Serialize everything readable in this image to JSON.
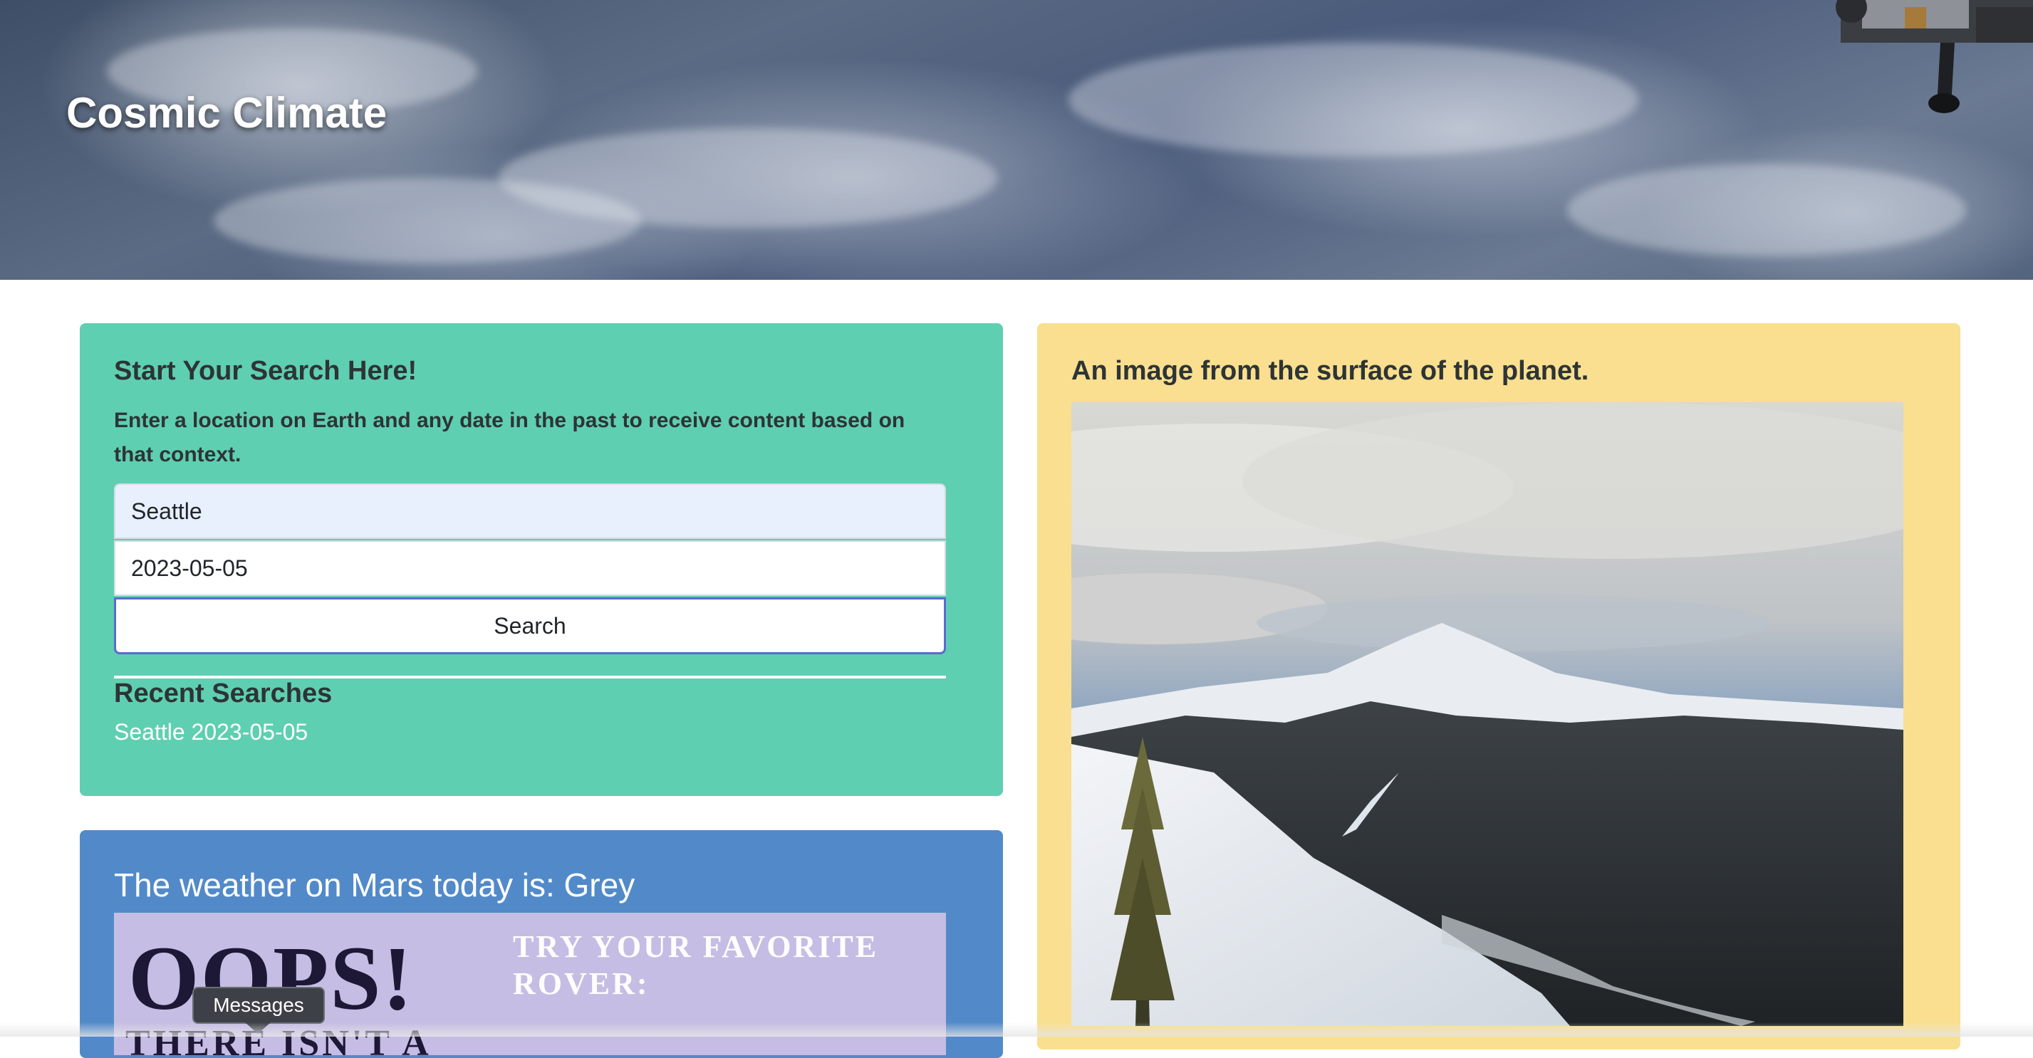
{
  "hero": {
    "title": "Cosmic Climate"
  },
  "search_card": {
    "heading": "Start Your Search Here!",
    "description": "Enter a location on Earth and any date in the past to receive content based on that context.",
    "location_value": "Seattle",
    "date_value": "2023-05-05",
    "search_button_label": "Search",
    "recent_heading": "Recent Searches",
    "recent_items": [
      "Seattle 2023-05-05"
    ]
  },
  "mars_card": {
    "title": "The weather on Mars today is: Grey",
    "image_text": {
      "headline": "OOPS!",
      "subline": "THERE ISN'T A",
      "right_text": "TRY YOUR FAVORITE ROVER:"
    }
  },
  "earth_card": {
    "heading": "An image from the surface of the planet."
  },
  "tooltip": {
    "label": "Messages"
  },
  "colors": {
    "search_card_bg": "#5fcfb1",
    "mars_card_bg": "#528ac9",
    "earth_card_bg": "#f9df8f",
    "search_button_border": "#5b6ad0",
    "location_field_bg": "#e8f0fe"
  }
}
